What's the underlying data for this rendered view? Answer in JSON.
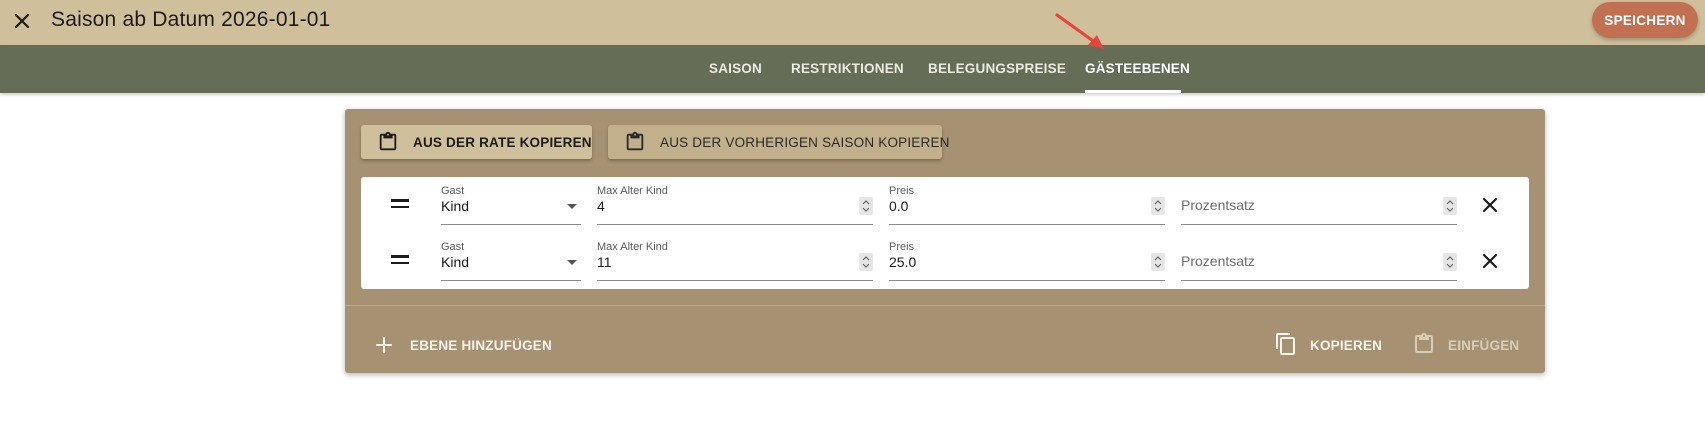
{
  "header": {
    "title": "Saison ab Datum 2026-01-01",
    "save_label": "SPEICHERN"
  },
  "tabs": [
    {
      "label": "SAISON",
      "active": false
    },
    {
      "label": "RESTRIKTIONEN",
      "active": false
    },
    {
      "label": "BELEGUNGSPREISE",
      "active": false
    },
    {
      "label": "GÄSTEEBENEN",
      "active": true
    }
  ],
  "card": {
    "copy_from_rate_label": "AUS DER RATE KOPIEREN",
    "copy_from_prev_season_label": "AUS DER VORHERIGEN SAISON KOPIEREN",
    "rows": [
      {
        "guest_label": "Gast",
        "guest_value": "Kind",
        "max_age_label": "Max Alter Kind",
        "max_age_value": "4",
        "price_label": "Preis",
        "price_value": "0.0",
        "percent_placeholder": "Prozentsatz"
      },
      {
        "guest_label": "Gast",
        "guest_value": "Kind",
        "max_age_label": "Max Alter Kind",
        "max_age_value": "11",
        "price_label": "Preis",
        "price_value": "25.0",
        "percent_placeholder": "Prozentsatz"
      }
    ],
    "add_level_label": "EBENE HINZUFÜGEN",
    "copy_label": "KOPIEREN",
    "paste_label": "EINFÜGEN"
  },
  "colors": {
    "topbar": "#d0bf9b",
    "tabbar": "#656d56",
    "card": "#a69172",
    "save_button": "#c27052",
    "annotation_arrow": "#e8453c"
  },
  "icons": [
    "close-icon",
    "clipboard-icon",
    "drag-handle-icon",
    "chevron-down-icon",
    "spin-arrows-icon",
    "delete-icon",
    "plus-icon",
    "copy-icon",
    "paste-icon",
    "annotation-arrow"
  ]
}
